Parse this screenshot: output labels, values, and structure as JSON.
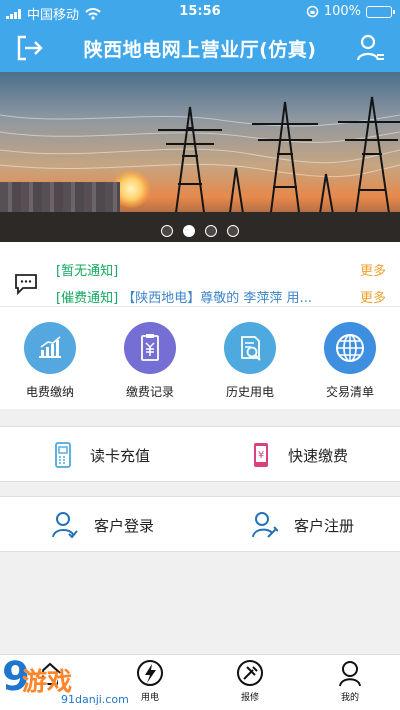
{
  "status_bar": {
    "carrier": "中国移动",
    "time": "15:56",
    "battery": "100%"
  },
  "header": {
    "title": "陕西地电网上营业厅(仿真)",
    "logout_icon": "logout-icon",
    "profile_icon": "user-profile-icon"
  },
  "banner": {
    "active_slide": 2,
    "slide_count": 4
  },
  "notices": [
    {
      "tag": "[暂无通知]",
      "message": "",
      "more": "更多"
    },
    {
      "tag": "[催费通知]",
      "message": "【陕西地电】尊敬的 李萍萍 用...",
      "more": "更多"
    }
  ],
  "menu": [
    {
      "label": "电费缴纳",
      "icon": "bar-chart-icon",
      "color": "#55a8df"
    },
    {
      "label": "缴费记录",
      "icon": "payment-record-icon",
      "color": "#746ed5"
    },
    {
      "label": "历史用电",
      "icon": "history-document-icon",
      "color": "#4ea9de"
    },
    {
      "label": "交易清单",
      "icon": "globe-icon",
      "color": "#3e8fdf"
    }
  ],
  "actions": {
    "card_recharge": "读卡充值",
    "quick_pay": "快速缴费",
    "login": "客户登录",
    "register": "客户注册"
  },
  "tabs": [
    {
      "label": "",
      "icon": "home-icon"
    },
    {
      "label": "用电",
      "icon": "lightning-icon"
    },
    {
      "label": "报修",
      "icon": "repair-icon"
    },
    {
      "label": "我的",
      "icon": "user-icon"
    }
  ],
  "watermark": {
    "brand_number": "9",
    "brand_text": "游戏",
    "url": "91danji.com"
  },
  "colors": {
    "primary": "#3fa7ea",
    "notice_tag": "#15a85f",
    "notice_text": "#3c85c9",
    "more": "#f3a12f"
  }
}
